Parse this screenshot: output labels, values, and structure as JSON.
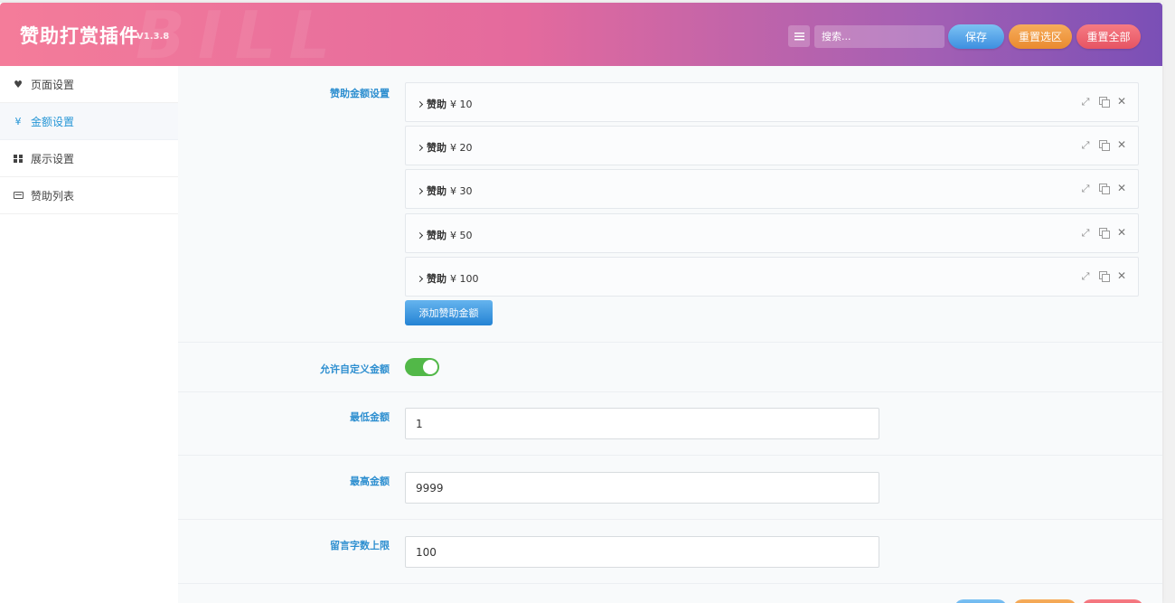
{
  "header": {
    "title": "赞助打赏插件",
    "version": "V1.3.8",
    "watermark": "BILL",
    "search_placeholder": "搜索...",
    "save_label": "保存",
    "reset_section_label": "重置选区",
    "reset_all_label": "重置全部"
  },
  "sidebar": {
    "items": [
      {
        "label": "页面设置",
        "icon": "heart-icon",
        "active": false
      },
      {
        "label": "金额设置",
        "icon": "yen-icon",
        "active": true
      },
      {
        "label": "展示设置",
        "icon": "grid-icon",
        "active": false
      },
      {
        "label": "赞助列表",
        "icon": "list-icon",
        "active": false
      }
    ]
  },
  "amounts": {
    "label": "赞助金额设置",
    "items": [
      {
        "name": "赞助",
        "amount": "¥ 10"
      },
      {
        "name": "赞助",
        "amount": "¥ 20"
      },
      {
        "name": "赞助",
        "amount": "¥ 30"
      },
      {
        "name": "赞助",
        "amount": "¥ 50"
      },
      {
        "name": "赞助",
        "amount": "¥ 100"
      }
    ],
    "add_label": "添加赞助金额"
  },
  "custom_amount": {
    "label": "允许自定义金额",
    "enabled": true
  },
  "min_amount": {
    "label": "最低金额",
    "value": "1"
  },
  "max_amount": {
    "label": "最高金额",
    "value": "9999"
  },
  "message_limit": {
    "label": "留言字数上限",
    "value": "100"
  },
  "colors": {
    "accent": "#2e8fd0",
    "toggle_on": "#52b848",
    "save": "#3d8fe0",
    "reset_section": "#ea8a2f",
    "reset_all": "#e65463"
  }
}
